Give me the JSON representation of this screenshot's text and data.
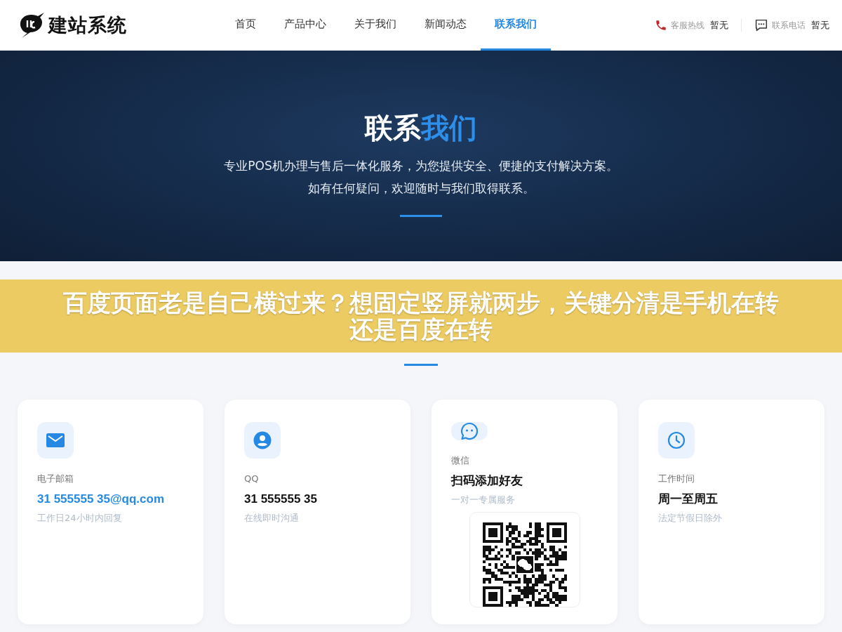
{
  "header": {
    "logo": {
      "text": "建站系统"
    },
    "nav": [
      {
        "label": "首页",
        "selected": false
      },
      {
        "label": "产品中心",
        "selected": false
      },
      {
        "label": "关于我们",
        "selected": false
      },
      {
        "label": "新闻动态",
        "selected": false
      },
      {
        "label": "联系我们",
        "selected": true
      }
    ],
    "contacts": [
      {
        "kind": "phone",
        "label": "客服热线",
        "value": "暂无"
      },
      {
        "kind": "chat",
        "label": "联系电话",
        "value": "暂无"
      }
    ]
  },
  "hero": {
    "title_plain": "联系",
    "title_accent": "我们",
    "lines": [
      "专业POS机办理与售后一体化服务，为您提供安全、便捷的支付解决方案。",
      "如有任何疑问，欢迎随时与我们取得联系。"
    ]
  },
  "cards": [
    {
      "kind": "email",
      "label": "电子邮箱",
      "value": "31 555555 35@qq.com",
      "note": "工作日24小时内回复"
    },
    {
      "kind": "qq",
      "label": "QQ",
      "value": "31 555555 35",
      "note": "在线即时沟通"
    },
    {
      "kind": "wechat",
      "label": "微信",
      "value": "扫码添加好友",
      "note": "一对一专属服务"
    },
    {
      "kind": "hours",
      "label": "工作时间",
      "value": "周一至周五",
      "note": "法定节假日除外"
    }
  ],
  "overlay_banner": {
    "text": "百度页面老是自己横过来？想固定竖屏就两步，关键分清是手机在转还是百度在转"
  }
}
